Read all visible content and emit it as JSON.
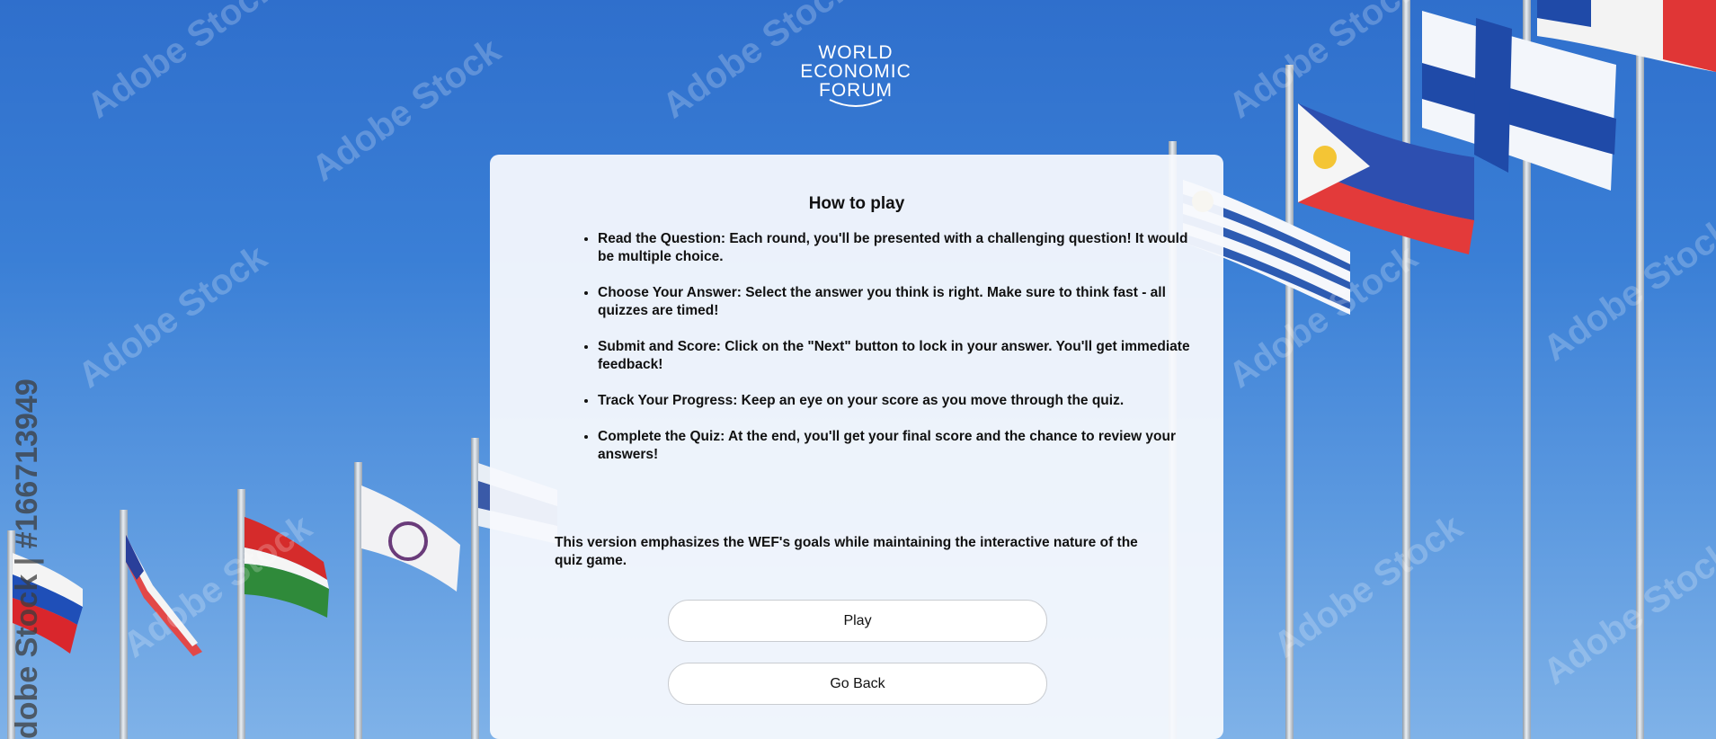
{
  "logo": {
    "lines": [
      "WORLD",
      "ECONOMIC",
      "FORUM"
    ],
    "icon": "wef-arc-icon"
  },
  "background": {
    "watermark_text": "Adobe Stock",
    "stock_id_text": "dobe Stock | #166713949"
  },
  "how_to_play": {
    "title": "How to play",
    "rules": [
      "Read the Question: Each round, you'll be presented with a challenging question! It would be multiple choice.",
      "Choose Your Answer: Select the answer you think is right. Make sure to think fast - all quizzes are timed!",
      "Submit and Score: Click on the \"Next\" button to lock in your answer. You'll get immediate feedback!",
      "Track Your Progress: Keep an eye on your score as you move through the quiz.",
      "Complete the Quiz: At the end, you'll get your final score and the chance to review your answers!"
    ],
    "note": "This version emphasizes the WEF's goals while maintaining the interactive nature of the quiz game."
  },
  "buttons": {
    "play": "Play",
    "go_back": "Go Back"
  },
  "colors": {
    "sky": "#3a7fd6",
    "card": "#f6f9fd",
    "button_bg": "#ffffff",
    "text": "#111111"
  }
}
